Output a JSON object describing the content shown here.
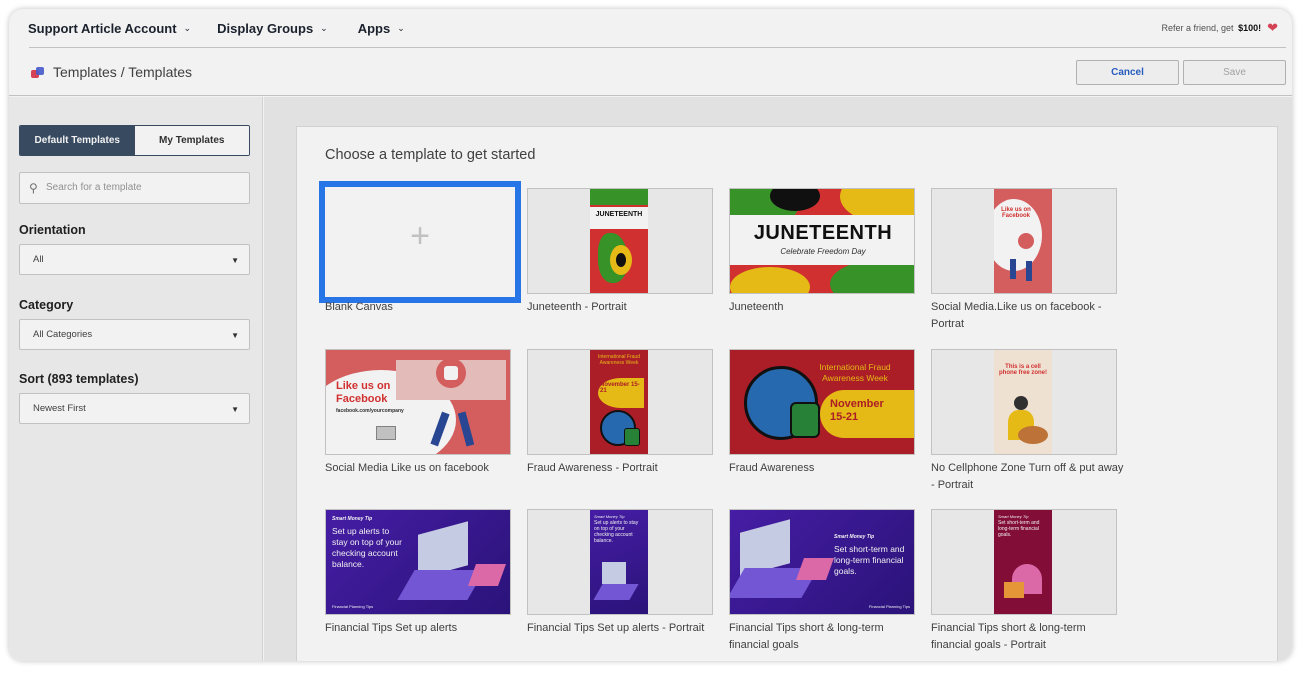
{
  "nav": {
    "account": "Support Article Account",
    "display_groups": "Display Groups",
    "apps": "Apps",
    "refer_prefix": "Refer a friend, get",
    "refer_amount": "$100!"
  },
  "breadcrumb": {
    "text": "Templates / Templates"
  },
  "actions": {
    "cancel": "Cancel",
    "save": "Save"
  },
  "sidebar": {
    "tabs": [
      "Default Templates",
      "My Templates"
    ],
    "search_placeholder": "Search for a template",
    "orientation_label": "Orientation",
    "orientation_value": "All",
    "category_label": "Category",
    "category_value": "All Categories",
    "sort_label": "Sort (893 templates)",
    "sort_value": "Newest First"
  },
  "main": {
    "title": "Choose a template to get started",
    "templates": [
      "Blank Canvas",
      "Juneteenth - Portrait",
      "Juneteenth",
      "Social Media.Like us on facebook - Portrat",
      "Social Media Like us on facebook",
      "Fraud Awareness - Portrait",
      "Fraud Awareness",
      "No Cellphone Zone Turn off & put away - Portrait",
      "Financial Tips Set up alerts",
      "Financial Tips Set up alerts - Portrait",
      "Financial Tips short & long-term financial goals",
      "Financial Tips short & long-term financial goals - Portrait"
    ]
  },
  "thumbs": {
    "juneteenth_p_title": "JUNETEENTH",
    "juneteenth_title": "JUNETEENTH",
    "juneteenth_sub": "Celebrate Freedom Day",
    "likeus_p": "Like us on Facebook",
    "likeus_title": "Like us on Facebook",
    "likeus_url": "facebook.com/yourcompany",
    "fraud_title": "International Fraud Awareness Week",
    "fraud_date": "November 15-21",
    "fraud_p_title": "International Fraud Awareness Week",
    "fraud_p_date": "November 15-21",
    "cell_title": "This is a cell phone free zone!",
    "money_tip": "Smart Money Tip",
    "alerts_text": "Set up alerts to stay on top of your checking account balance.",
    "goals_text": "Set short-term and long-term financial goals.",
    "footer": "Financial Planning Tips"
  },
  "colors": {
    "accent": "#2b7cf5",
    "nav_dark": "#3b4e66",
    "purple": "#4a1fae",
    "red": "#c52a2a",
    "pink": "#e06264"
  }
}
